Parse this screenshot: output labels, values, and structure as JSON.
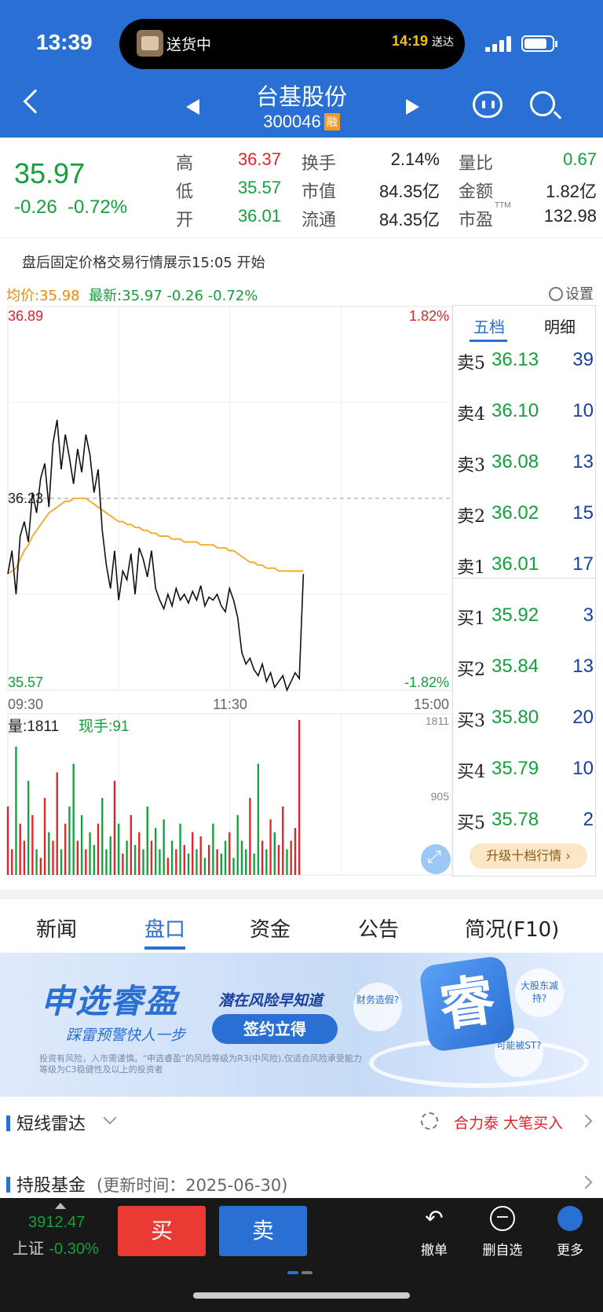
{
  "status": {
    "time": "13:39",
    "activity": "送货中",
    "eta_time": "14:19",
    "eta_suffix": "送达"
  },
  "header": {
    "name": "台基股份",
    "code": "300046",
    "badge": "融"
  },
  "quote": {
    "price": "35.97",
    "change": "-0.26",
    "change_pct": "-0.72%",
    "stats": [
      {
        "label": "高",
        "value": "36.37",
        "color": "red"
      },
      {
        "label": "低",
        "value": "35.57",
        "color": "grn"
      },
      {
        "label": "开",
        "value": "36.01",
        "color": "grn"
      },
      {
        "label": "换手",
        "value": "2.14%",
        "color": "blk"
      },
      {
        "label": "市值",
        "value": "84.35亿",
        "color": "blk"
      },
      {
        "label": "流通",
        "value": "84.35亿",
        "color": "blk"
      },
      {
        "label": "量比",
        "value": "0.67",
        "color": "grn"
      },
      {
        "label": "金额",
        "value": "1.82亿",
        "color": "blk"
      },
      {
        "label": "市盈",
        "value": "132.98",
        "color": "blk",
        "sup": "TTM"
      }
    ]
  },
  "notice": "盘后固定价格交易行情展示15:05 开始",
  "avg_line": {
    "avg": "均价:35.98",
    "latest": "最新:35.97 -0.26 -0.72%"
  },
  "settings_label": "设置",
  "chart_data": {
    "type": "line",
    "y_max_label": "36.89",
    "y_min_label": "35.57",
    "y_mid_label": "36.23",
    "pct_max": "1.82%",
    "pct_min": "-1.82%",
    "x_labels": [
      "09:30",
      "11:30",
      "15:00"
    ],
    "price": [
      35.97,
      36.05,
      35.9,
      36.1,
      36.15,
      36.08,
      36.25,
      36.18,
      36.3,
      36.35,
      36.2,
      36.42,
      36.5,
      36.33,
      36.45,
      36.37,
      36.28,
      36.4,
      36.32,
      36.45,
      36.38,
      36.25,
      36.33,
      36.12,
      36.0,
      35.92,
      36.05,
      35.88,
      35.98,
      35.95,
      36.04,
      35.9,
      36.06,
      36.02,
      35.96,
      36.05,
      35.92,
      35.88,
      35.85,
      35.9,
      35.86,
      35.92,
      35.88,
      35.9,
      35.87,
      35.91,
      35.88,
      35.93,
      35.86,
      35.89,
      35.88,
      35.9,
      35.86,
      35.84,
      35.92,
      35.88,
      35.82,
      35.7,
      35.66,
      35.68,
      35.64,
      35.62,
      35.66,
      35.6,
      35.63,
      35.58,
      35.6,
      35.62,
      35.57,
      35.6,
      35.63,
      35.61,
      35.97
    ],
    "avg": [
      35.97,
      35.98,
      35.99,
      36.02,
      36.05,
      36.07,
      36.1,
      36.12,
      36.14,
      36.16,
      36.18,
      36.19,
      36.2,
      36.21,
      36.22,
      36.22,
      36.23,
      36.23,
      36.23,
      36.23,
      36.22,
      36.21,
      36.2,
      36.19,
      36.18,
      36.17,
      36.16,
      36.15,
      36.15,
      36.14,
      36.14,
      36.13,
      36.13,
      36.12,
      36.12,
      36.11,
      36.11,
      36.1,
      36.1,
      36.1,
      36.09,
      36.09,
      36.09,
      36.08,
      36.08,
      36.08,
      36.08,
      36.07,
      36.07,
      36.07,
      36.07,
      36.06,
      36.06,
      36.06,
      36.05,
      36.05,
      36.04,
      36.03,
      36.02,
      36.01,
      36.01,
      36.0,
      36.0,
      35.99,
      35.99,
      35.99,
      35.98,
      35.98,
      35.98,
      35.98,
      35.98,
      35.98,
      35.98
    ],
    "vol_label": "量:1811",
    "cur_vol": "现手:91",
    "vol_max": "1811",
    "vol_mid": "905",
    "volume": [
      800,
      300,
      1500,
      600,
      400,
      1100,
      700,
      300,
      200,
      900,
      500,
      400,
      1200,
      300,
      600,
      800,
      1300,
      400,
      700,
      300,
      500,
      350,
      600,
      900,
      300,
      450,
      1100,
      600,
      250,
      400,
      700,
      350,
      500,
      300,
      800,
      400,
      550,
      300,
      650,
      200,
      400,
      300,
      600,
      350,
      250,
      500,
      300,
      450,
      200,
      350,
      600,
      300,
      250,
      400,
      500,
      200,
      700,
      400,
      300,
      900,
      250,
      1300,
      400,
      300,
      650,
      500,
      350,
      800,
      300,
      400,
      550,
      1811
    ]
  },
  "order_book": {
    "tabs": [
      "五档",
      "明细"
    ],
    "sells": [
      {
        "label": "卖5",
        "price": "36.13",
        "vol": "39"
      },
      {
        "label": "卖4",
        "price": "36.10",
        "vol": "10"
      },
      {
        "label": "卖3",
        "price": "36.08",
        "vol": "13"
      },
      {
        "label": "卖2",
        "price": "36.02",
        "vol": "15"
      },
      {
        "label": "卖1",
        "price": "36.01",
        "vol": "17"
      }
    ],
    "buys": [
      {
        "label": "买1",
        "price": "35.92",
        "vol": "3"
      },
      {
        "label": "买2",
        "price": "35.84",
        "vol": "13"
      },
      {
        "label": "买3",
        "price": "35.80",
        "vol": "20"
      },
      {
        "label": "买4",
        "price": "35.79",
        "vol": "10"
      },
      {
        "label": "买5",
        "price": "35.78",
        "vol": "2"
      }
    ],
    "upgrade": "升级十档行情 ›"
  },
  "nav_tabs": [
    "新闻",
    "盘口",
    "资金",
    "公告",
    "简况(F10)"
  ],
  "banner": {
    "brand": "申选睿盈",
    "slogan": "踩雷预警快人一步",
    "tagline": "潜在风险早知道",
    "cta": "签约立得",
    "disclaimer": "投资有风险，入市需谨慎。\"申选睿盈\"的风险等级为R3(中风险),仅适合风险承受能力等级为C3稳健性及以上的投资者",
    "big_char": "睿",
    "bubbles": [
      "财务造假?",
      "大股东减持?",
      "可能被ST?"
    ]
  },
  "sections": {
    "radar": "短线雷达",
    "radar_alert": "合力泰 大笔买入",
    "fund": "持股基金",
    "fund_update": "(更新时间：2025-06-30)"
  },
  "bottom": {
    "index_value": "3912.47",
    "index_name": "上证",
    "index_pct": "-0.30%",
    "buy": "买",
    "sell": "卖",
    "actions": [
      "撤单",
      "删自选",
      "更多"
    ]
  },
  "colors": {
    "accent": "#2a6fd3",
    "up": "#e0242a",
    "down": "#14a03c"
  }
}
